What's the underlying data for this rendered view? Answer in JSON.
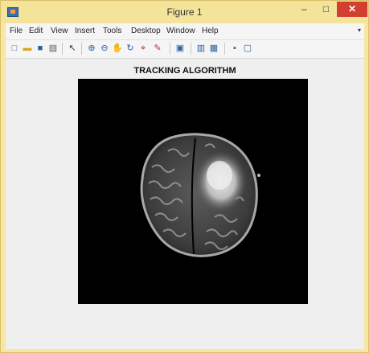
{
  "window": {
    "title": "Figure 1",
    "controls": {
      "minimize": "–",
      "maximize": "□",
      "close": "✕"
    }
  },
  "menubar": {
    "items": [
      "File",
      "Edit",
      "View",
      "Insert",
      "Tools",
      "Desktop",
      "Window",
      "Help"
    ],
    "overflow": "▾"
  },
  "toolbar": {
    "buttons": [
      {
        "icon": "new-figure-icon",
        "glyph": "□"
      },
      {
        "icon": "open-file-icon",
        "glyph": "▬"
      },
      {
        "icon": "save-icon",
        "glyph": "■"
      },
      {
        "icon": "print-icon",
        "glyph": "▤"
      },
      {
        "icon": "pointer-icon",
        "glyph": "↖"
      },
      {
        "icon": "zoom-in-icon",
        "glyph": "⊕"
      },
      {
        "icon": "zoom-out-icon",
        "glyph": "⊖"
      },
      {
        "icon": "pan-icon",
        "glyph": "✋"
      },
      {
        "icon": "rotate-3d-icon",
        "glyph": "↻"
      },
      {
        "icon": "data-cursor-icon",
        "glyph": "⌖"
      },
      {
        "icon": "brush-icon",
        "glyph": "✎"
      },
      {
        "icon": "link-plot-icon",
        "glyph": "▣"
      },
      {
        "icon": "colorbar-icon",
        "glyph": "▥"
      },
      {
        "icon": "legend-icon",
        "glyph": "▦"
      },
      {
        "icon": "hide-plot-tools-icon",
        "glyph": "▪"
      },
      {
        "icon": "show-plot-tools-icon",
        "glyph": "▢"
      }
    ]
  },
  "figure": {
    "axes_title": "TRACKING ALGORITHM",
    "image_description_icon": "brain-mri-icon",
    "colors": {
      "axes_bg": "#000000",
      "figure_bg": "#efefef",
      "window_frame": "#f6e8a4",
      "close_button": "#d23f31"
    }
  }
}
